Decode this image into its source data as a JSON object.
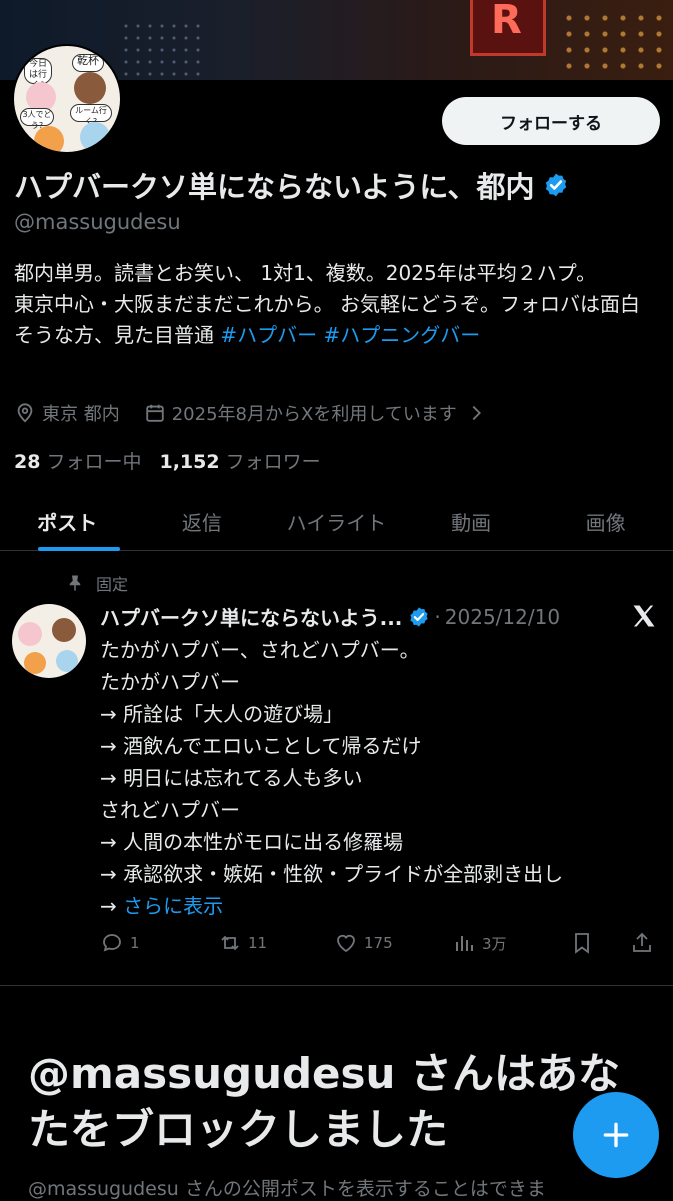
{
  "profile": {
    "name": "ハプバークソ単にならないように、都内",
    "handle": "@massugudesu",
    "follow_label": "フォローする",
    "bio": {
      "line1": "都内単男。読書とお笑い、 1対1、複数。2025年は平均２ハプ。",
      "line2": "東京中心・大阪まだまだこれから。 お気軽にどうぞ。フォロバは面白そうな方、見た目普通 ",
      "tag1": "#ハプバー",
      "tag2": "#ハプニングバー"
    },
    "location": "東京 都内",
    "joined": "2025年8月からXを利用しています",
    "following_count": "28",
    "following_label": "フォロー中",
    "followers_count": "1,152",
    "followers_label": "フォロワー",
    "avatar_text": [
      "今日は行く?",
      "乾杯",
      "3人でどう?",
      "ルーム行く?"
    ]
  },
  "tabs": [
    "ポスト",
    "返信",
    "ハイライト",
    "動画",
    "画像"
  ],
  "pinned_post": {
    "pinned_label": "固定",
    "author": "ハプバークソ単にならないよう...",
    "dot": "·",
    "date": "2025/12/10",
    "body": "たかがハプバー、されどハプバー。\nたかがハプバー\n→ 所詮は「大人の遊び場」\n→ 酒飲んでエロいことして帰るだけ\n→ 明日には忘れてる人も多い\nされどハプバー\n→ 人間の本性がモロに出る修羅場\n→ 承認欲求・嫉妬・性欲・プライドが全部剥き出し\n→ ",
    "more": "さらに表示",
    "replies": "1",
    "reposts": "11",
    "likes": "175",
    "views": "3万"
  },
  "blocked": {
    "title": "@massugudesu さんはあなたをブロックしました",
    "subtitle": "@massugudesu さんの公開ポストを表示することはできま"
  },
  "colors": {
    "accent": "#1d9bf0",
    "background": "#000000",
    "text": "#e7e9ea",
    "muted": "#71767b"
  }
}
